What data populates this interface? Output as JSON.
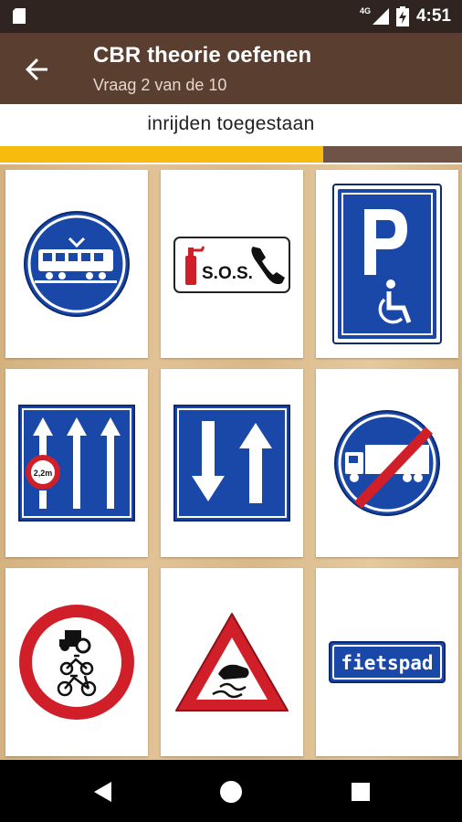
{
  "status_bar": {
    "time": "4:51",
    "network": "4G",
    "icons": [
      "sd-card-icon",
      "signal-icon",
      "battery-charging-icon"
    ]
  },
  "app_bar": {
    "title": "CBR theorie oefenen",
    "subtitle": "Vraag 2 van de 10",
    "back_icon": "arrow-back-icon"
  },
  "question": {
    "text": "inrijden toegestaan"
  },
  "progress": {
    "fraction": 0.7
  },
  "signs": [
    {
      "id": "tram-route",
      "icon": "tram-sign-icon"
    },
    {
      "id": "sos-emergency",
      "icon": "sos-sign-icon",
      "text": "S.O.S."
    },
    {
      "id": "disabled-parking",
      "icon": "disabled-parking-sign-icon"
    },
    {
      "id": "lanes-width-restriction",
      "icon": "lanes-sign-icon",
      "text": "2,2m"
    },
    {
      "id": "two-way-traffic",
      "icon": "two-way-sign-icon"
    },
    {
      "id": "end-truck-route",
      "icon": "end-truck-sign-icon"
    },
    {
      "id": "no-motor-vehicles-cycles",
      "icon": "no-vehicles-sign-icon"
    },
    {
      "id": "slippery-road",
      "icon": "slippery-road-sign-icon"
    },
    {
      "id": "bicycle-path",
      "icon": "fietspad-sign-icon",
      "text": "fietspad"
    }
  ],
  "nav_bar": {
    "buttons": [
      "back-triangle-icon",
      "home-circle-icon",
      "recents-square-icon"
    ]
  },
  "colors": {
    "status_bar": "#2f2420",
    "app_bar": "#5a3f31",
    "progress_fill": "#f7bb0d",
    "progress_track": "#6f5347",
    "sign_blue": "#1a48a8",
    "sign_red": "#d11f2a"
  }
}
